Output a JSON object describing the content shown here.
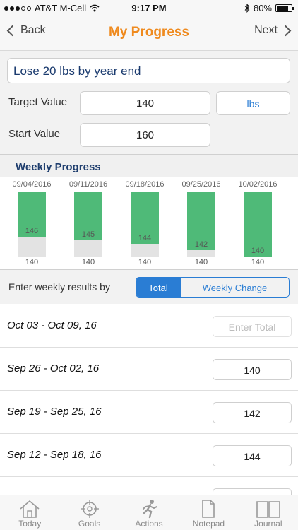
{
  "status_bar": {
    "carrier": "AT&T M-Cell",
    "time": "9:17 PM",
    "battery": "80%"
  },
  "nav": {
    "back_label": "Back",
    "title": "My Progress",
    "next_label": "Next"
  },
  "goal": {
    "name": "Lose 20 lbs by year end",
    "target_label": "Target Value",
    "target_value": "140",
    "unit": "lbs",
    "start_label": "Start Value",
    "start_value": "160"
  },
  "weekly_progress": {
    "title": "Weekly Progress",
    "weeks": [
      {
        "date": "09/04/2016",
        "value": "146",
        "target": "140",
        "progress": 0.7
      },
      {
        "date": "09/11/2016",
        "value": "145",
        "target": "140",
        "progress": 0.75
      },
      {
        "date": "09/18/2016",
        "value": "144",
        "target": "140",
        "progress": 0.8
      },
      {
        "date": "09/25/2016",
        "value": "142",
        "target": "140",
        "progress": 0.9
      },
      {
        "date": "10/02/2016",
        "value": "140",
        "target": "140",
        "progress": 1.0
      }
    ]
  },
  "results_mode": {
    "label": "Enter weekly results by",
    "options": [
      "Total",
      "Weekly Change"
    ],
    "selected": "Total"
  },
  "weekly_entries": [
    {
      "range": "Oct 03 - Oct 09, 16",
      "value": "",
      "placeholder": "Enter Total"
    },
    {
      "range": "Sep 26 - Oct 02, 16",
      "value": "140",
      "placeholder": ""
    },
    {
      "range": "Sep 19 - Sep 25, 16",
      "value": "142",
      "placeholder": ""
    },
    {
      "range": "Sep 12 - Sep 18, 16",
      "value": "144",
      "placeholder": ""
    }
  ],
  "tabs": [
    "Today",
    "Goals",
    "Actions",
    "Notepad",
    "Journal"
  ],
  "colors": {
    "accent_orange": "#ef8a1e",
    "blue": "#2a7dd4",
    "bar_green": "#4fba78",
    "navy": "#1f3e6e"
  }
}
